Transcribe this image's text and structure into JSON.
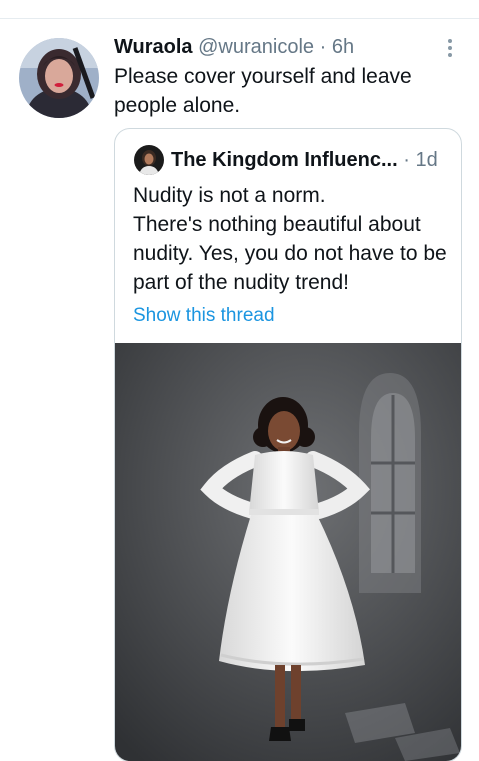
{
  "tweet": {
    "author_name": "Wuraola",
    "handle": "@wuranicole",
    "separator": "·",
    "time": "6h",
    "text": "Please cover yourself and leave people alone.",
    "avatar_icon": "user-avatar",
    "more_icon": "more-options-icon"
  },
  "quoted_tweet": {
    "author_name": "The Kingdom Influenc...",
    "separator": "·",
    "time": "1d",
    "lines": [
      "Nudity is not a norm.",
      "There's nothing beautiful about nudity. Yes, you do not have to be part of the nudity trend!"
    ],
    "link_text": "Show this thread",
    "media_icon": "photo-woman-white-dress"
  },
  "colors": {
    "text": "#0f1419",
    "secondary": "#657786",
    "link": "#1b95e0",
    "border": "#cfd9de"
  }
}
